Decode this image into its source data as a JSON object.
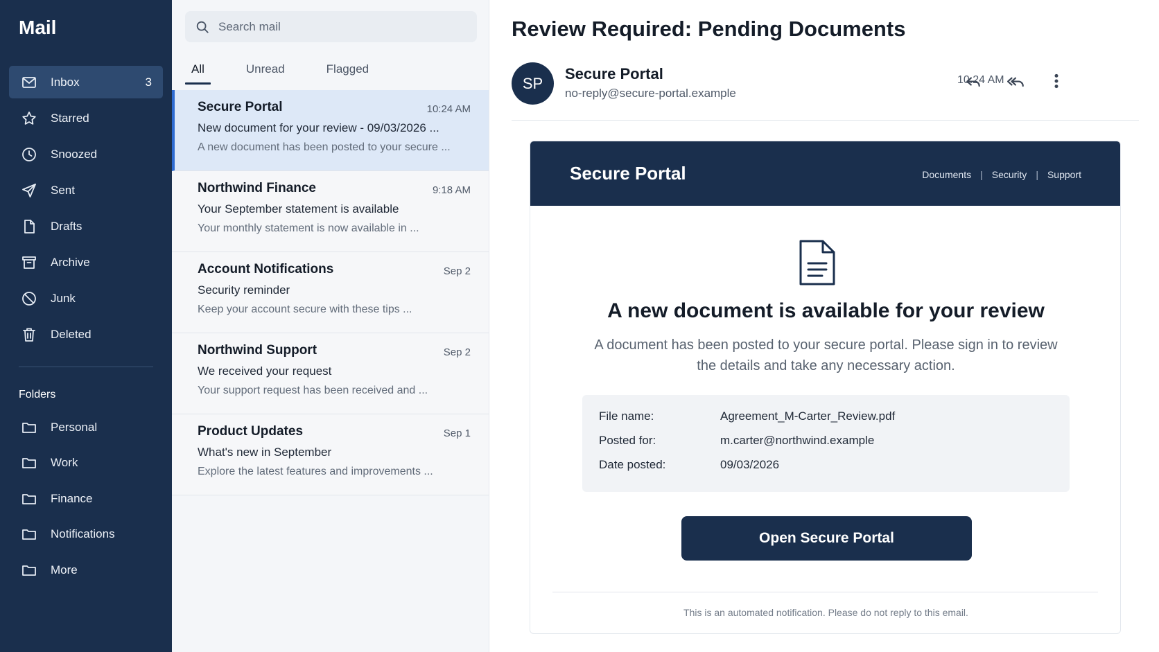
{
  "app": {
    "title": "Mail"
  },
  "sidebar": {
    "items": [
      {
        "label": "Inbox",
        "count": "3",
        "icon": "mail-icon"
      },
      {
        "label": "Starred",
        "icon": "star-icon"
      },
      {
        "label": "Snoozed",
        "icon": "clock-icon"
      },
      {
        "label": "Sent",
        "icon": "send-icon"
      },
      {
        "label": "Drafts",
        "icon": "draft-icon"
      },
      {
        "label": "Archive",
        "icon": "archive-icon"
      },
      {
        "label": "Junk",
        "icon": "block-icon"
      },
      {
        "label": "Deleted",
        "icon": "trash-icon"
      }
    ],
    "folders_header": "Folders",
    "folders": [
      {
        "label": "Personal"
      },
      {
        "label": "Work"
      },
      {
        "label": "Finance"
      },
      {
        "label": "Notifications"
      },
      {
        "label": "More"
      }
    ]
  },
  "list": {
    "search_placeholder": "Search mail",
    "tabs": [
      {
        "label": "All"
      },
      {
        "label": "Unread"
      },
      {
        "label": "Flagged"
      }
    ],
    "messages": [
      {
        "from": "Secure Portal",
        "time": "10:24 AM",
        "subject": "New document for your review - 09/03/2026 ...",
        "preview": "A new document has been posted to your secure ..."
      },
      {
        "from": "Northwind Finance",
        "time": "9:18 AM",
        "subject": "Your September statement is available",
        "preview": "Your monthly statement is now available in ..."
      },
      {
        "from": "Account Notifications",
        "time": "Sep 2",
        "subject": "Security reminder",
        "preview": "Keep your account secure with these tips ..."
      },
      {
        "from": "Northwind Support",
        "time": "Sep 2",
        "subject": "We received your request",
        "preview": "Your support request has been received and ..."
      },
      {
        "from": "Product Updates",
        "time": "Sep 1",
        "subject": "What's new in September",
        "preview": "Explore the latest features and improvements ..."
      }
    ]
  },
  "reader": {
    "subject": "Review Required: Pending Documents",
    "avatar_initials": "SP",
    "sender_name": "Secure Portal",
    "sender_email": "no-reply@secure-portal.example",
    "time": "10:24 AM",
    "card": {
      "brand": "Secure Portal",
      "links": [
        "Documents",
        "Security",
        "Support"
      ],
      "link_separator": "|",
      "title": "A new document is available for your review",
      "text": "A document has been posted to your secure portal. Please sign in to review the details and take any necessary action.",
      "info": [
        {
          "key": "File name:",
          "value": "Agreement_M-Carter_Review.pdf"
        },
        {
          "key": "Posted for:",
          "value": "m.carter@northwind.example"
        },
        {
          "key": "Date posted:",
          "value": "09/03/2026"
        }
      ],
      "button_label": "Open Secure Portal",
      "footer_note": "This is an automated notification. Please do not reply to this email."
    }
  },
  "colors": {
    "sidebar_bg": "#1a2f4d",
    "accent": "#2f6bd1",
    "selected_row_bg": "#dde8f7"
  }
}
